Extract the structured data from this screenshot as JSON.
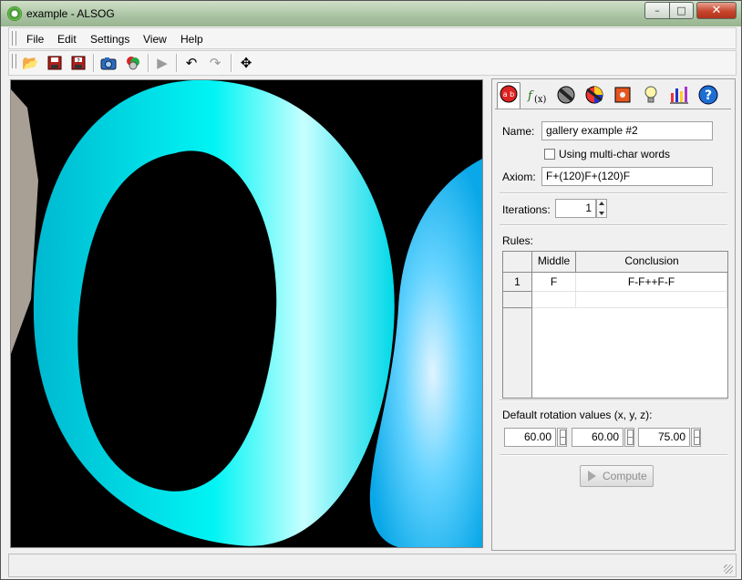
{
  "window": {
    "title": "example - ALSOG"
  },
  "menu": {
    "items": [
      "File",
      "Edit",
      "Settings",
      "View",
      "Help"
    ]
  },
  "toolbar": {
    "icons": [
      "open-folder-icon",
      "save-icon",
      "save-as-icon",
      "camera-icon",
      "render-icon",
      "play-icon",
      "undo-icon",
      "redo-icon",
      "move-view-icon"
    ]
  },
  "tabs": {
    "icons": [
      "grammar-icon",
      "functions-icon",
      "material-icon",
      "color-icon",
      "texture-icon",
      "light-icon",
      "statistics-icon",
      "help-icon"
    ]
  },
  "form": {
    "name_label": "Name:",
    "name_value": "gallery example #2",
    "multichar_label": "Using multi-char words",
    "axiom_label": "Axiom:",
    "axiom_value": "F+(120)F+(120)F",
    "iterations_label": "Iterations:",
    "iterations_value": "1",
    "rules_label": "Rules:"
  },
  "rules_table": {
    "headers": [
      "Middle",
      "Conclusion"
    ],
    "rows": [
      {
        "num": "1",
        "middle": "F",
        "conclusion": "F-F++F-F"
      }
    ]
  },
  "rotation": {
    "label": "Default rotation values (x, y, z):",
    "x": "60.00",
    "y": "60.00",
    "z": "75.00"
  },
  "compute_label": "Compute",
  "colors": {
    "torus": "#00e5e5",
    "background": "#000000"
  }
}
